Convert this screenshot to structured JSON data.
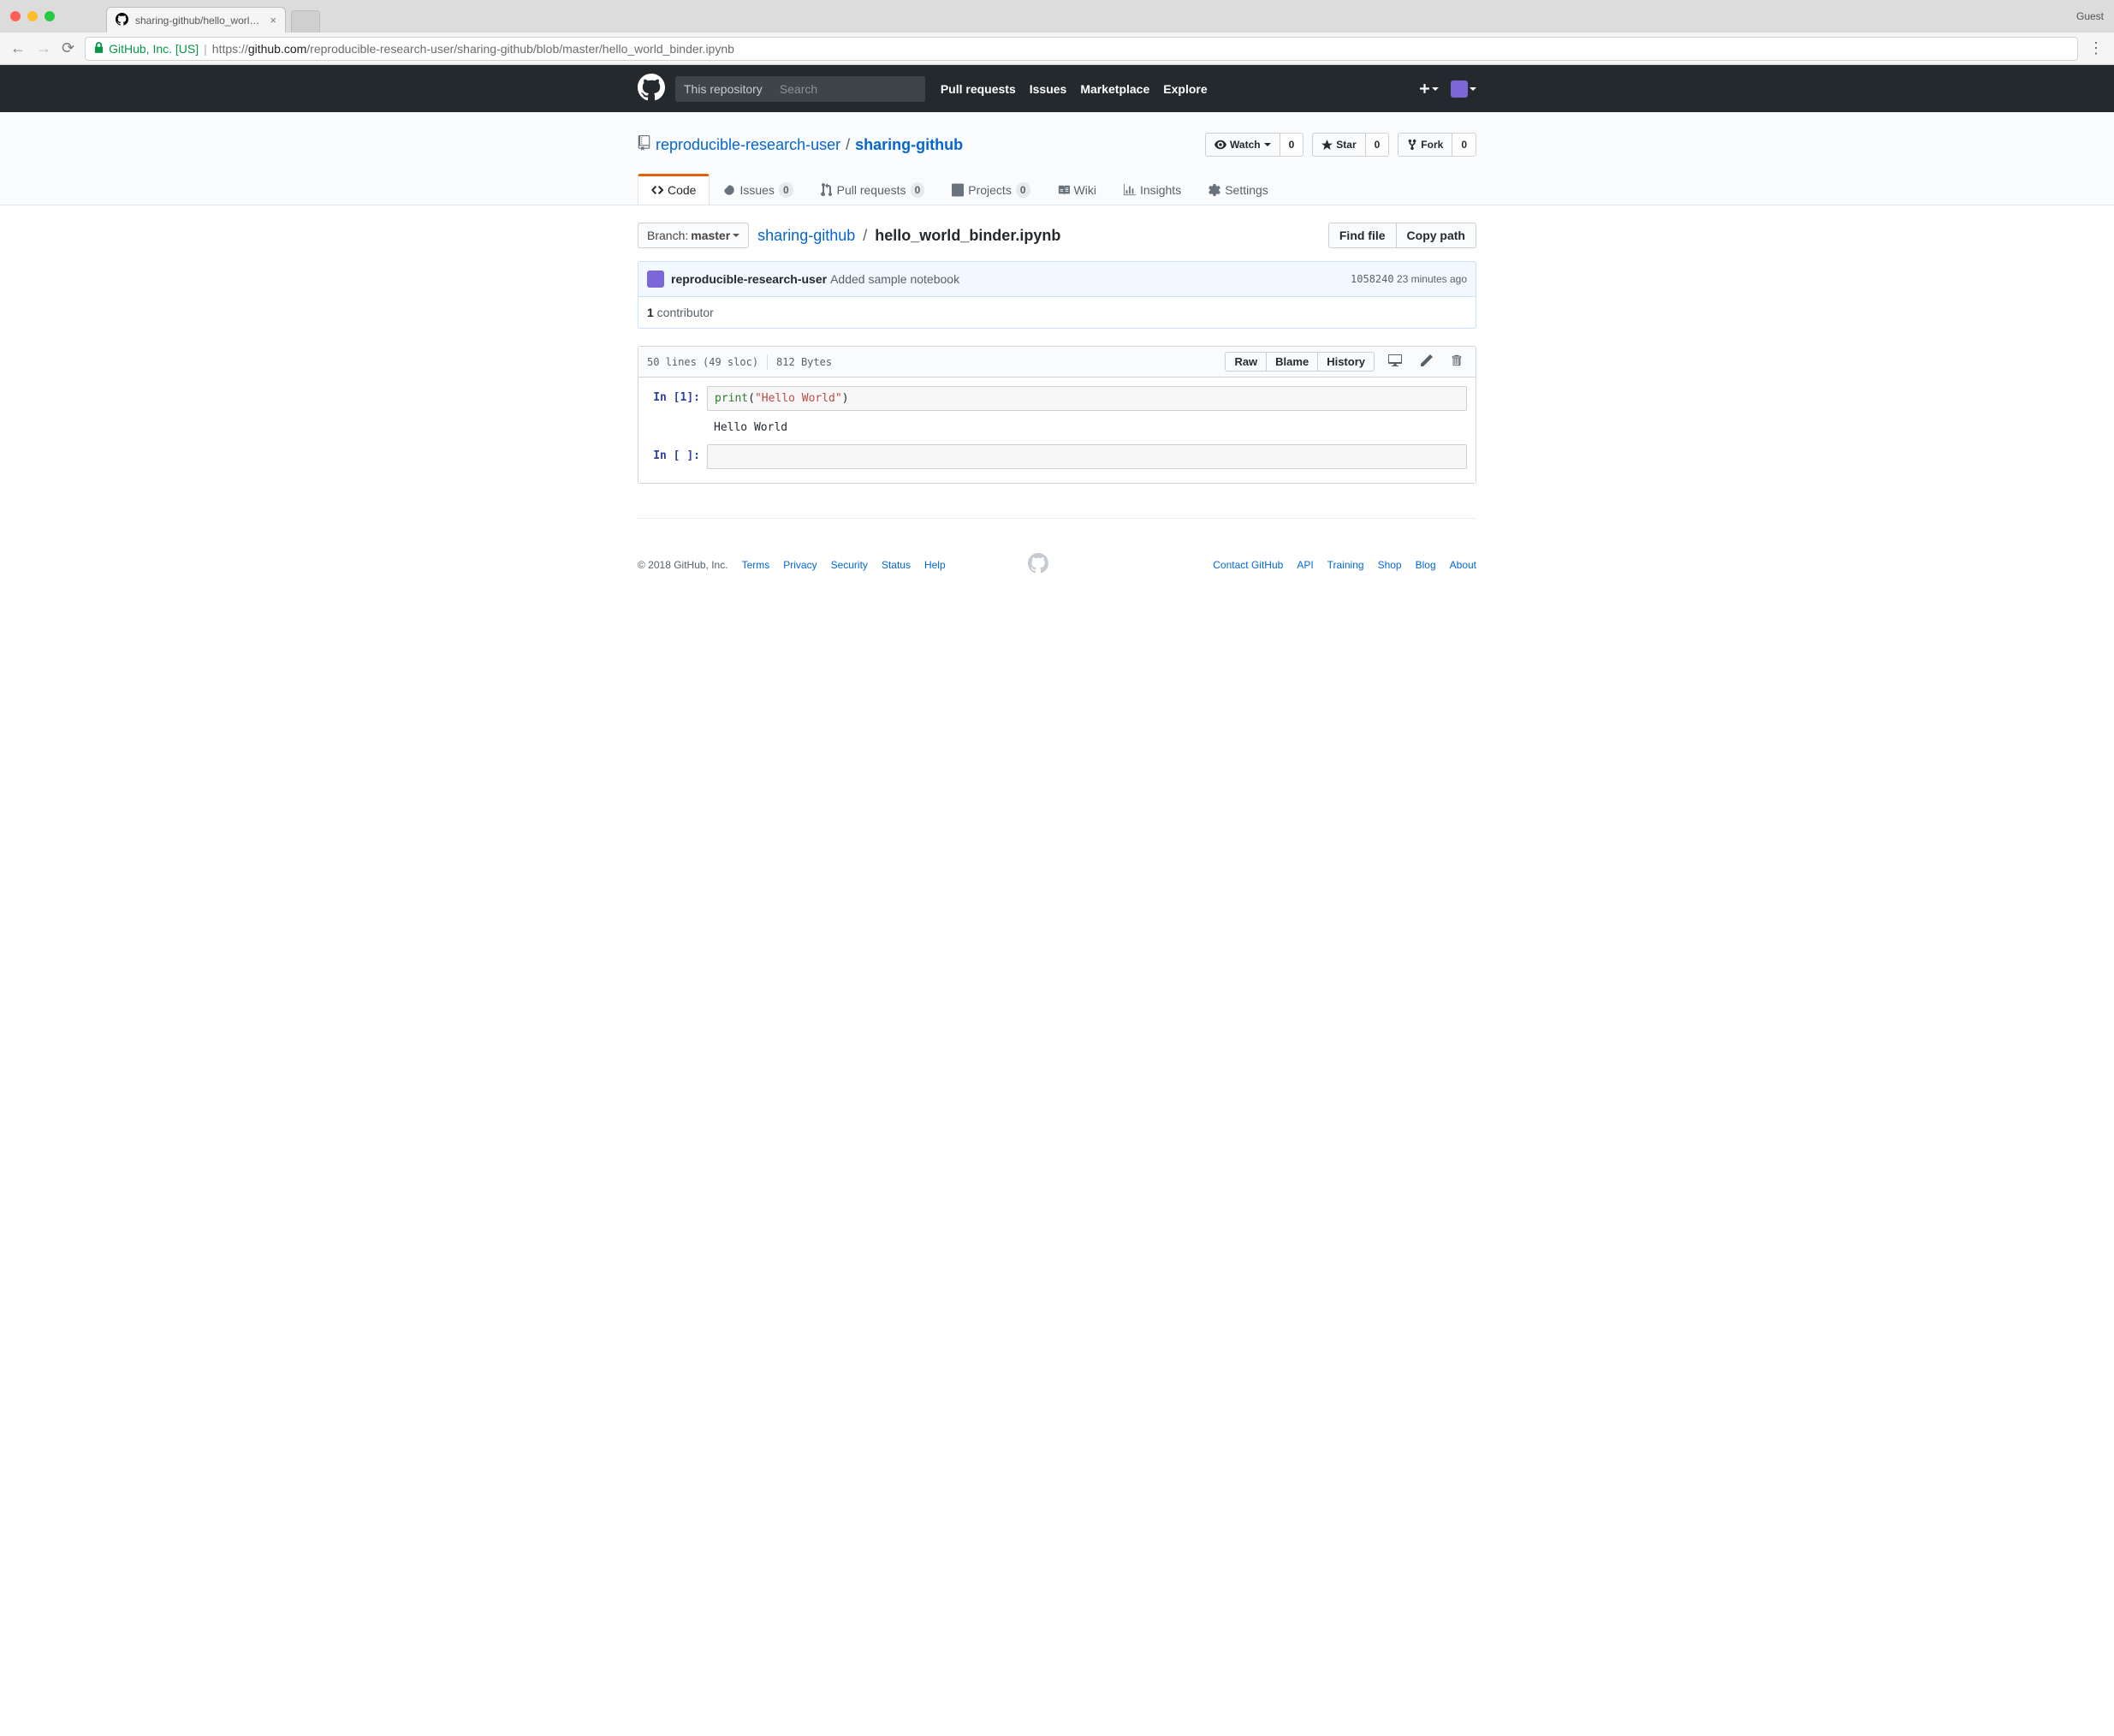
{
  "browser": {
    "tab_title": "sharing-github/hello_world_bin",
    "guest": "Guest",
    "url_company": "GitHub, Inc. [US]",
    "url_prefix": "https://",
    "url_domain": "github.com",
    "url_path": "/reproducible-research-user/sharing-github/blob/master/hello_world_binder.ipynb"
  },
  "gh_header": {
    "scope": "This repository",
    "search_placeholder": "Search",
    "nav": {
      "pulls": "Pull requests",
      "issues": "Issues",
      "marketplace": "Marketplace",
      "explore": "Explore"
    }
  },
  "repo": {
    "owner": "reproducible-research-user",
    "name": "sharing-github",
    "actions": {
      "watch": "Watch",
      "watch_count": "0",
      "star": "Star",
      "star_count": "0",
      "fork": "Fork",
      "fork_count": "0"
    },
    "tabs": {
      "code": "Code",
      "issues": "Issues",
      "issues_count": "0",
      "pulls": "Pull requests",
      "pulls_count": "0",
      "projects": "Projects",
      "projects_count": "0",
      "wiki": "Wiki",
      "insights": "Insights",
      "settings": "Settings"
    }
  },
  "file": {
    "branch_label": "Branch:",
    "branch": "master",
    "path_repo": "sharing-github",
    "path_file": "hello_world_binder.ipynb",
    "find_file": "Find file",
    "copy_path": "Copy path",
    "commit": {
      "author": "reproducible-research-user",
      "message": "Added sample notebook",
      "sha": "1058240",
      "time": "23 minutes ago"
    },
    "contributors_count": "1",
    "contributors_label": " contributor",
    "info_lines": "50 lines (49 sloc)",
    "info_size": "812 Bytes",
    "buttons": {
      "raw": "Raw",
      "blame": "Blame",
      "history": "History"
    }
  },
  "notebook": {
    "cell1_prompt": "In [1]:",
    "cell1_fn": "print",
    "cell1_paren_open": "(",
    "cell1_str": "\"Hello World\"",
    "cell1_paren_close": ")",
    "cell1_output": "Hello World",
    "cell2_prompt": "In [ ]:"
  },
  "footer": {
    "copyright": "© 2018 GitHub, Inc.",
    "links_left": {
      "terms": "Terms",
      "privacy": "Privacy",
      "security": "Security",
      "status": "Status",
      "help": "Help"
    },
    "links_right": {
      "contact": "Contact GitHub",
      "api": "API",
      "training": "Training",
      "shop": "Shop",
      "blog": "Blog",
      "about": "About"
    }
  }
}
